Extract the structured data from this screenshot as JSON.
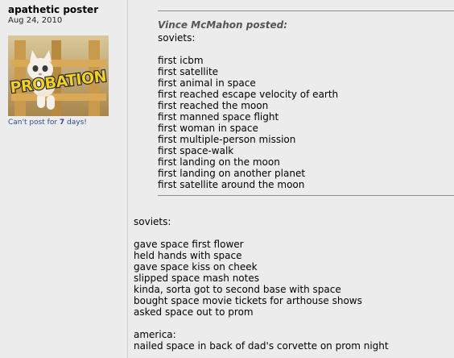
{
  "user": {
    "name": "apathetic poster",
    "join_date": "Aug 24, 2010",
    "avatar_banner": "PROBATION",
    "probation_prefix": "Can't post for ",
    "probation_days": "7",
    "probation_suffix": " days!"
  },
  "quote": {
    "author": "Vince McMahon posted:",
    "intro": "soviets:",
    "items": [
      "first icbm",
      "first satellite",
      "first animal in space",
      "first reached escape velocity of earth",
      "first reached the moon",
      "first manned space flight",
      "first woman in space",
      "first multiple-person mission",
      "first space-walk",
      "first landing on the moon",
      "first landing on another planet",
      "first satellite around the moon"
    ]
  },
  "reply": {
    "soviets_heading": "soviets:",
    "soviets_items": [
      "gave space first flower",
      "held hands with space",
      "gave space kiss on cheek",
      "slipped space mash notes",
      "kinda, sorta got to second base with space",
      "bought space movie tickets for arthouse shows",
      "asked space out to prom"
    ],
    "america_heading": "america:",
    "america_items": [
      "nailed space in back of dad's corvette on prom night"
    ]
  },
  "colors": {
    "background": "#ececec",
    "note_blue": "#2a4f8a",
    "banner_yellow": "#f2d21a",
    "quote_author_gray": "#555555",
    "rule_gray": "#8f8f8f"
  },
  "icons": {
    "avatar": "kitten-behind-fence-avatar"
  }
}
